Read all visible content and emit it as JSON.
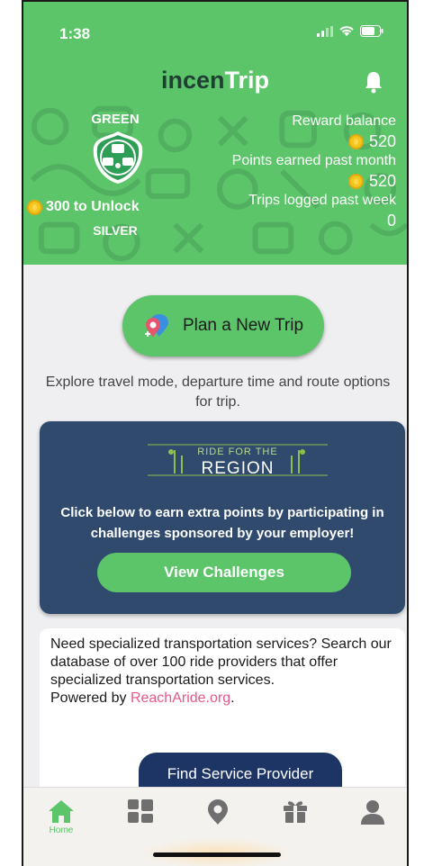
{
  "status_bar": {
    "time": "1:38"
  },
  "header": {
    "logo_part1": "incen",
    "logo_part2": "Trip"
  },
  "rewards": {
    "current_level": "GREEN",
    "unlock_points": "300",
    "unlock_text": "to Unlock",
    "next_level": "SILVER",
    "reward_balance_label": "Reward balance",
    "reward_balance_value": "520",
    "points_month_label": "Points earned past month",
    "points_month_value": "520",
    "trips_week_label": "Trips logged past week",
    "trips_week_value": "0"
  },
  "plan": {
    "button_label": "Plan a New Trip",
    "description": "Explore travel mode, departure time and route options for trip."
  },
  "challenge": {
    "banner_small": "RIDE FOR THE",
    "banner_big": "REGION",
    "text": "Click below to earn extra points by participating in challenges sponsored by your employer!",
    "button_label": "View Challenges"
  },
  "service": {
    "text": "Need specialized transportation services? Search our database of over 100 ride providers that offer specialized transportation services.",
    "powered_prefix": "Powered by",
    "powered_link": "ReachAride.org",
    "powered_suffix": ".",
    "button_label": "Find Service Provider"
  },
  "tab_bar": {
    "home_label": "Home",
    "active_color": "#5cc56a",
    "inactive_color": "#6f6f6f"
  },
  "colors": {
    "brand_green": "#5cc56a",
    "challenge_navy": "#2f4a6d",
    "button_navy": "#1d3565",
    "link_pink": "#e8588a"
  }
}
